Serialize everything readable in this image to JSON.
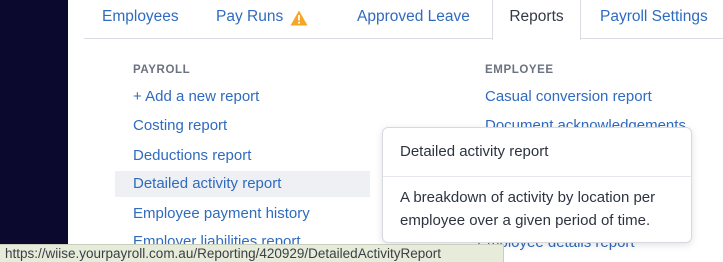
{
  "tabs": {
    "employees": "Employees",
    "pay_runs": "Pay Runs",
    "approved_leave": "Approved Leave",
    "reports": "Reports",
    "payroll_settings": "Payroll Settings"
  },
  "warning_color": "#f5a623",
  "payroll": {
    "heading": "PAYROLL",
    "items": [
      "+ Add a new report",
      "Costing report",
      "Deductions report",
      "Detailed activity report",
      "Employee payment history",
      "Employer liabilities report"
    ]
  },
  "employee": {
    "heading": "EMPLOYEE",
    "items": [
      "Casual conversion report",
      "Document acknowledgements",
      "Employee details report"
    ]
  },
  "tooltip": {
    "title": "Detailed activity report",
    "description": "A breakdown of activity by location per employee over a given period of time."
  },
  "status_url": "https://wiise.yourpayroll.com.au/Reporting/420929/DetailedActivityReport"
}
